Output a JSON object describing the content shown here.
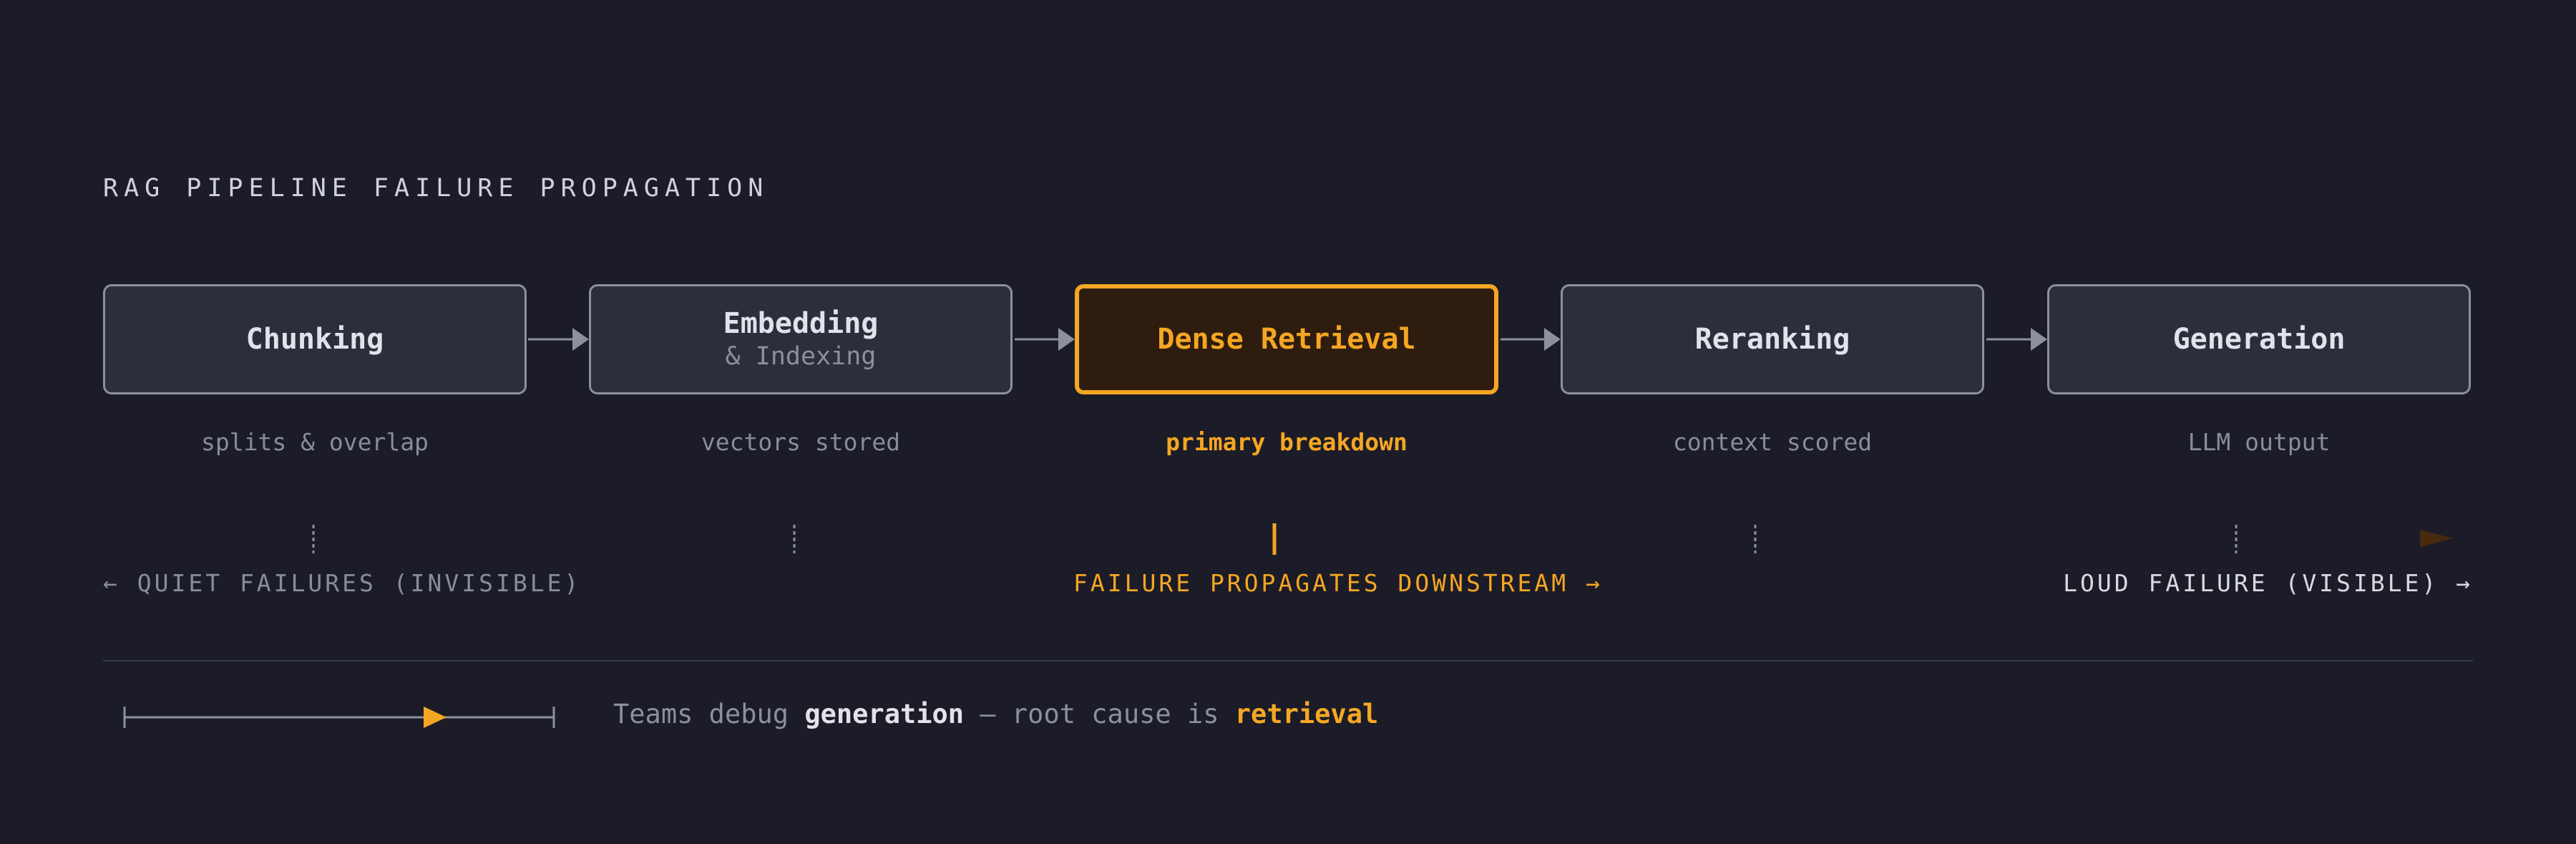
{
  "title": "RAG PIPELINE FAILURE PROPAGATION",
  "colors": {
    "background": "#1b1c27",
    "box_fill": "#2b2e3b",
    "box_border": "#8e909e",
    "accent": "#f5a623",
    "accent_fill": "#2e1d0f",
    "muted_text": "#8a8c99",
    "bright_text": "#e1e2ea"
  },
  "stages": [
    {
      "label": "Chunking",
      "sub": "",
      "caption": "splits & overlap",
      "highlight": false
    },
    {
      "label": "Embedding",
      "sub": "& Indexing",
      "caption": "vectors stored",
      "highlight": false
    },
    {
      "label": "Dense Retrieval",
      "sub": "",
      "caption": "primary breakdown",
      "highlight": true
    },
    {
      "label": "Reranking",
      "sub": "",
      "caption": "context scored",
      "highlight": false
    },
    {
      "label": "Generation",
      "sub": "",
      "caption": "LLM output",
      "highlight": false
    }
  ],
  "timeline": {
    "quiet_label": "← QUIET FAILURES (INVISIBLE)",
    "propagate_label": "FAILURE PROPAGATES DOWNSTREAM →",
    "loud_label": "LOUD FAILURE (VISIBLE) →"
  },
  "summary": {
    "prefix": "Teams debug ",
    "emphasis": "generation",
    "middle": " — root cause is ",
    "accent": "retrieval"
  }
}
